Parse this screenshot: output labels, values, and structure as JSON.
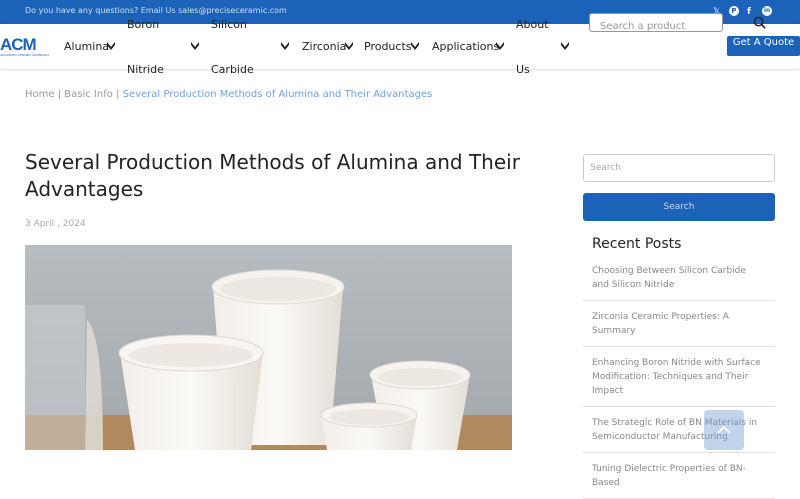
{
  "topbar": {
    "contact": "Do you have any questions? Email Us sales@preciseceramic.com",
    "social": {
      "x": "𝕏",
      "pinterest": "P",
      "facebook": "f",
      "linkedin": "in"
    }
  },
  "logo": {
    "text": "ACM",
    "tagline": "ADVANCED CERAMIC MATERIALS"
  },
  "nav": {
    "alumina": "Alumina",
    "boron_nitride_1": "Boron",
    "boron_nitride_2": "Nitride",
    "silicon_carbide_1": "Silicon",
    "silicon_carbide_2": "Carbide",
    "zirconia": "Zirconia",
    "products": "Products",
    "applications": "Applications",
    "about_1": "About",
    "about_2": "Us"
  },
  "header_search": {
    "placeholder": "Search a product"
  },
  "quote_button": {
    "label": "Get A Quote"
  },
  "breadcrumb": {
    "home": "Home",
    "sep1": " | ",
    "basic": "Basic Info",
    "sep2": " | ",
    "current": "Several Production Methods of Alumina and Their Advantages"
  },
  "article": {
    "title": "Several Production Methods of Alumina and Their Advantages",
    "date": "3 April , 2024"
  },
  "sidebar": {
    "search_placeholder": "Search",
    "search_button": "Search",
    "recent_title": "Recent Posts",
    "recent_posts": [
      "Choosing Between Silicon Carbide and Silicon Nitride",
      "Zirconia Ceramic Properties: A Summary",
      "Enhancing Boron Nitride with Surface Modification: Techniques and Their Impact",
      "The Strategic Role of BN Materials in Semiconductor Manufacturing",
      "Tuning Dielectric Properties of BN-Based"
    ]
  },
  "colors": {
    "brand": "#1b62b8",
    "link": "#6fa0dc"
  },
  "icons": [
    "x-icon",
    "pinterest-icon",
    "facebook-icon",
    "linkedin-icon",
    "search-icon",
    "chevron-down-icon",
    "back-to-top-icon"
  ]
}
